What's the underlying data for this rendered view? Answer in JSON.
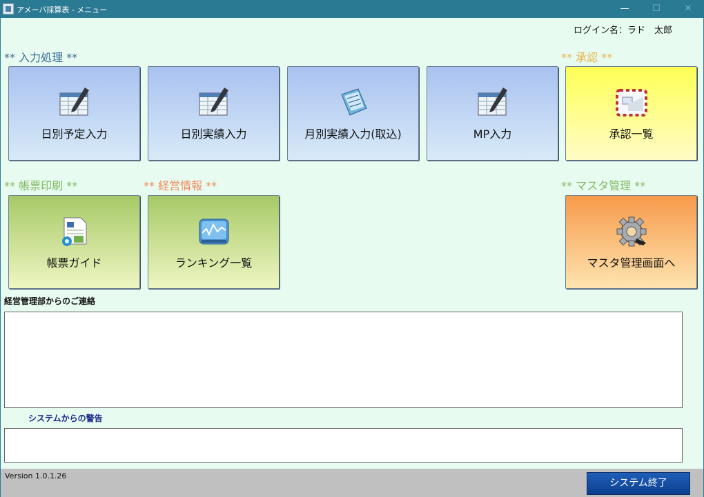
{
  "window": {
    "title": "アメーバ採算表 - メニュー",
    "min": "—",
    "max": "☐",
    "close": "✕"
  },
  "login": "ログイン名：ラド　太郎",
  "sections": {
    "input": "** 入力処理 **",
    "approve": "** 承認 **",
    "report": "** 帳票印刷 **",
    "mgmt": "** 経営情報 **",
    "master": "** マスタ管理 **"
  },
  "tiles": [
    {
      "label": "日別予定入力",
      "icon": "spreadsheet-pencil-icon"
    },
    {
      "label": "日別実績入力",
      "icon": "spreadsheet-pencil-icon"
    },
    {
      "label": "月別実績入力(取込)",
      "icon": "document-import-icon"
    },
    {
      "label": "MP入力",
      "icon": "spreadsheet-pencil-icon"
    },
    {
      "label": "承認一覧",
      "icon": "airmail-envelope-icon"
    },
    {
      "label": "帳票ガイド",
      "icon": "report-document-icon"
    },
    {
      "label": "ランキング一覧",
      "icon": "chart-graph-icon"
    },
    {
      "label": "マスタ管理画面へ",
      "icon": "gear-icon"
    }
  ],
  "messages": {
    "label": "経営管理部からのご連絡",
    "content": ""
  },
  "warnings": {
    "label": "システムからの警告",
    "content": ""
  },
  "footer": {
    "version": "Version 1.0.1.26",
    "exit": "システム終了"
  },
  "colors": {
    "titlebar": "#2b7a93",
    "background": "#e8fbf0",
    "exit_button": "#1552a8"
  }
}
